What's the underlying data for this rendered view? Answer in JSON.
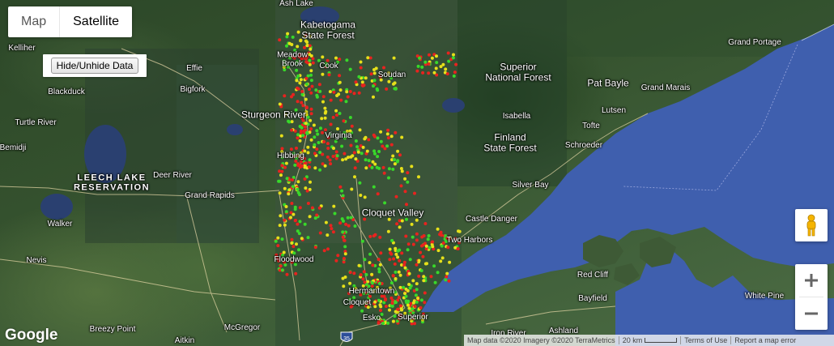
{
  "map_type": {
    "options": [
      "Map",
      "Satellite"
    ],
    "selected": "Satellite"
  },
  "toggle_data_button": "Hide/Unhide Data",
  "places": [
    {
      "label": "Ash Lake",
      "style": "normal"
    },
    {
      "label": "Kabetogama\nState Forest",
      "style": "big"
    },
    {
      "label": "Kelliher",
      "style": "normal"
    },
    {
      "label": "Meadow\nBrook",
      "style": "normal"
    },
    {
      "label": "Cook",
      "style": "normal"
    },
    {
      "label": "Soudan",
      "style": "normal"
    },
    {
      "label": "Superior\nNational Forest",
      "style": "big"
    },
    {
      "label": "Effie",
      "style": "normal"
    },
    {
      "label": "Bigfork",
      "style": "normal"
    },
    {
      "label": "Blackduck",
      "style": "normal"
    },
    {
      "label": "Sturgeon River",
      "style": "big"
    },
    {
      "label": "Isabella",
      "style": "normal"
    },
    {
      "label": "Pat Bayle",
      "style": "big"
    },
    {
      "label": "Grand Marais",
      "style": "normal"
    },
    {
      "label": "Grand Portage",
      "style": "normal"
    },
    {
      "label": "Lutsen",
      "style": "normal"
    },
    {
      "label": "Tofte",
      "style": "normal"
    },
    {
      "label": "Turtle River",
      "style": "normal"
    },
    {
      "label": "Virginia",
      "style": "normal"
    },
    {
      "label": "Finland\nState Forest",
      "style": "big"
    },
    {
      "label": "Schroeder",
      "style": "normal"
    },
    {
      "label": "Bemidji",
      "style": "normal"
    },
    {
      "label": "Hibbing",
      "style": "normal"
    },
    {
      "label": "LEECH LAKE\nRESERVATION",
      "style": "bold"
    },
    {
      "label": "Deer River",
      "style": "normal"
    },
    {
      "label": "Silver Bay",
      "style": "normal"
    },
    {
      "label": "Grand Rapids",
      "style": "normal"
    },
    {
      "label": "Cloquet Valley",
      "style": "big"
    },
    {
      "label": "Walker",
      "style": "normal"
    },
    {
      "label": "Castle Danger",
      "style": "normal"
    },
    {
      "label": "Two Harbors",
      "style": "normal"
    },
    {
      "label": "Nevis",
      "style": "normal"
    },
    {
      "label": "Floodwood",
      "style": "normal"
    },
    {
      "label": "Red Cliff",
      "style": "normal"
    },
    {
      "label": "Hermantown",
      "style": "normal"
    },
    {
      "label": "Cloquet",
      "style": "normal"
    },
    {
      "label": "Bayfield",
      "style": "normal"
    },
    {
      "label": "White Pine",
      "style": "normal"
    },
    {
      "label": "Breezy Point",
      "style": "normal"
    },
    {
      "label": "McGregor",
      "style": "normal"
    },
    {
      "label": "Esko",
      "style": "normal"
    },
    {
      "label": "Superior",
      "style": "normal"
    },
    {
      "label": "Ashland",
      "style": "normal"
    },
    {
      "label": "Aitkin",
      "style": "normal"
    },
    {
      "label": "Iron River",
      "style": "normal"
    }
  ],
  "highway_shield": "35",
  "google_logo": "Google",
  "attribution": {
    "imagery": "Map data ©2020 Imagery ©2020 TerraMetrics",
    "scale": "20 km",
    "terms": "Terms of Use",
    "report": "Report a map error"
  },
  "colors": {
    "lake": "#3f5fae",
    "dot_red": "#e8231f",
    "dot_yellow": "#e6e01a",
    "dot_green": "#38d82a",
    "road": "#e8d9a8"
  },
  "icons": {
    "pegman": "pegman-icon",
    "zoom_in": "plus-icon",
    "zoom_out": "minus-icon"
  }
}
